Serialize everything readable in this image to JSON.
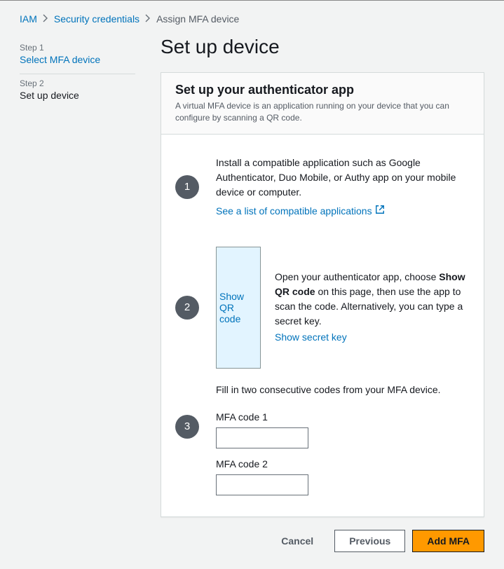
{
  "breadcrumb": {
    "items": [
      {
        "label": "IAM"
      },
      {
        "label": "Security credentials"
      }
    ],
    "current": "Assign MFA device"
  },
  "sidebar": {
    "step1_label": "Step 1",
    "step1_name": "Select MFA device",
    "step2_label": "Step 2",
    "step2_name": "Set up device"
  },
  "page_title": "Set up device",
  "panel": {
    "title": "Set up your authenticator app",
    "desc": "A virtual MFA device is an application running on your device that you can configure by scanning a QR code."
  },
  "step1": {
    "num": "1",
    "text": "Install a compatible application such as Google Authenticator, Duo Mobile, or Authy app on your mobile device or computer.",
    "link": "See a list of compatible applications"
  },
  "step2": {
    "num": "2",
    "qr_label": "Show QR code",
    "text1": "Open your authenticator app, choose ",
    "bold": "Show QR code",
    "text2": " on this page, then use the app to scan the code. Alternatively, you can type a secret key.",
    "secret_link": "Show secret key"
  },
  "step3": {
    "num": "3",
    "desc": "Fill in two consecutive codes from your MFA device.",
    "code1_label": "MFA code 1",
    "code1_value": "",
    "code2_label": "MFA code 2",
    "code2_value": ""
  },
  "footer": {
    "cancel": "Cancel",
    "previous": "Previous",
    "add": "Add MFA"
  }
}
